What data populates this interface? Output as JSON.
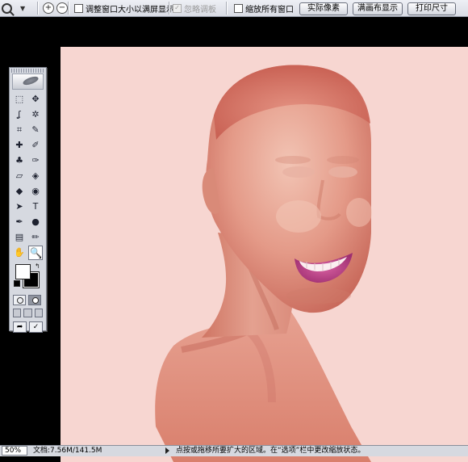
{
  "options_bar": {
    "zoom_in_symbol": "+",
    "zoom_out_symbol": "−",
    "resize_windows_label": "调整窗口大小以满屏显示",
    "ignore_palettes_label": "忽略调板",
    "ignore_palettes_check": "✓",
    "zoom_all_windows_label": "缩放所有窗口",
    "actual_pixels_label": "实际像素",
    "fit_screen_label": "满画布显示",
    "print_size_label": "打印尺寸"
  },
  "toolbox": {
    "icons": [
      "marquee-icon",
      "move-icon",
      "lasso-icon",
      "magic-wand-icon",
      "crop-icon",
      "slice-icon",
      "healing-brush-icon",
      "brush-icon",
      "clone-stamp-icon",
      "history-brush-icon",
      "eraser-icon",
      "paint-bucket-icon",
      "blur-icon",
      "dodge-icon",
      "path-selection-icon",
      "type-icon",
      "pen-icon",
      "ellipse-icon",
      "notes-icon",
      "eyedropper-icon",
      "hand-icon",
      "zoom-icon"
    ],
    "glyphs": [
      "⬚",
      "✥",
      "ʆ",
      "✲",
      "⌗",
      "✎",
      "✚",
      "✐",
      "♣",
      "✑",
      "▱",
      "◈",
      "◆",
      "◉",
      "➤",
      "T",
      "✒",
      "●",
      "▤",
      "✏",
      "✋",
      "🔍"
    ],
    "swap_glyph": "↰",
    "foreground_color": "#ffffff",
    "background_color": "#000000",
    "jump_label": "➦",
    "imageready_label": "✓"
  },
  "status_bar": {
    "zoom": "50%",
    "doc_size": "文档:7.56M/141.5M",
    "hint": "点按或拖移所要扩大的区域。在“选项”栏中更改缩放状态。"
  },
  "canvas": {
    "background_color": "#f7d6d1",
    "subject": "portrait-painting"
  }
}
